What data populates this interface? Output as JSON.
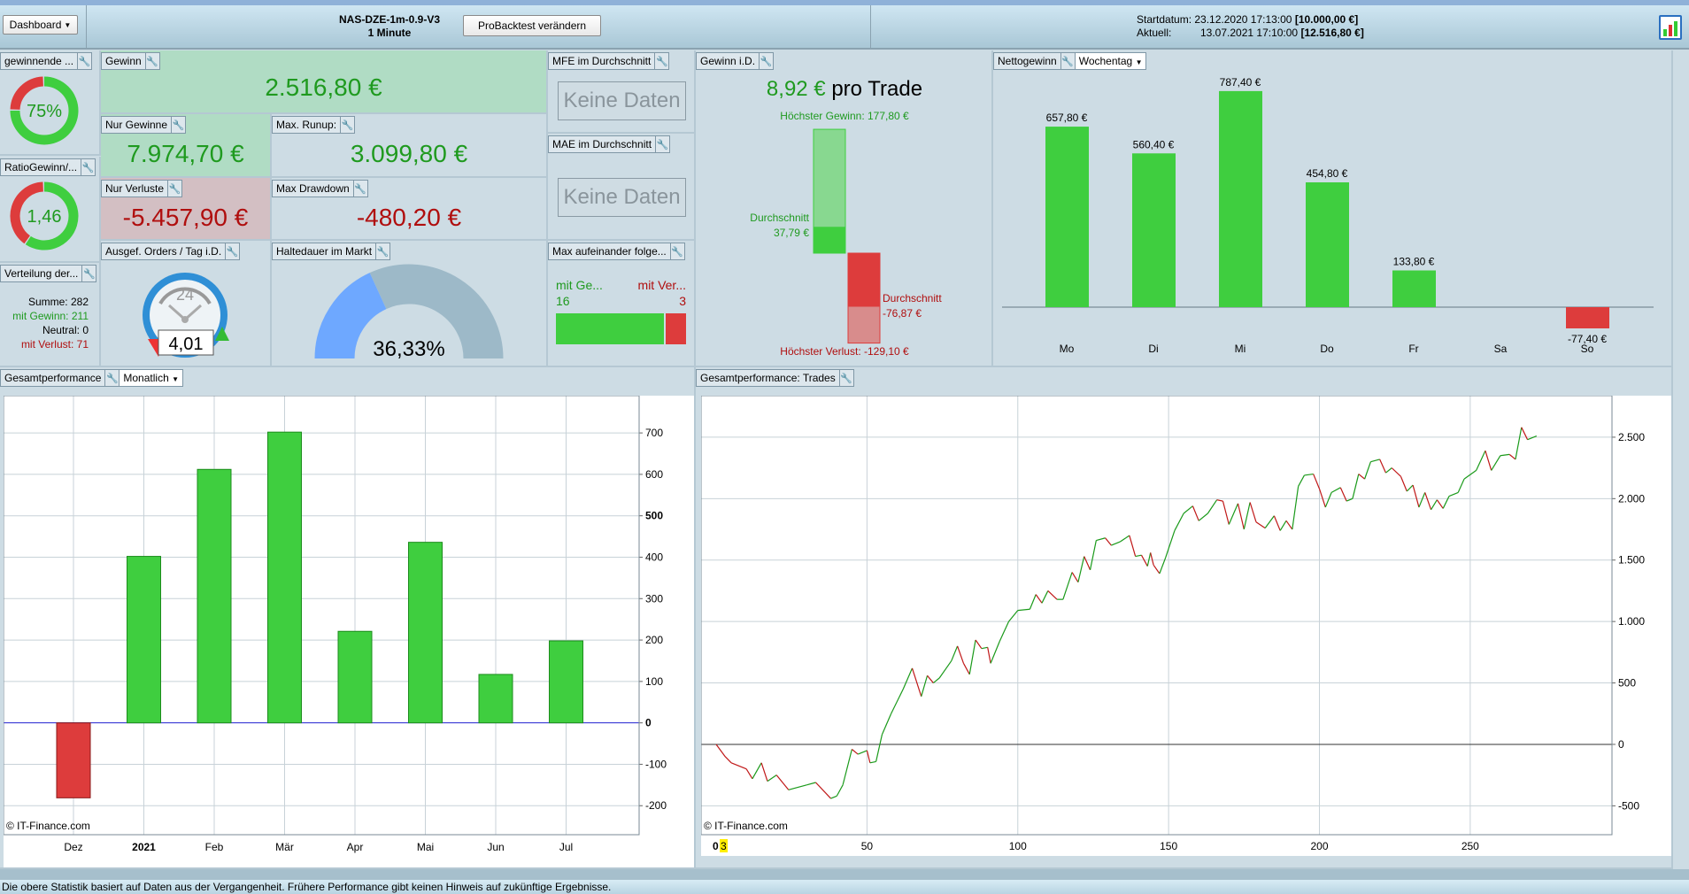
{
  "header": {
    "dashboard_label": "Dashboard",
    "strategy_name": "NAS-DZE-1m-0.9-V3",
    "timeframe": "1 Minute",
    "change_button": "ProBacktest verändern",
    "start_label": "Startdatum:",
    "start_date": "23.12.2020 17:13:00",
    "start_capital": "[10.000,00 €]",
    "current_label": "Aktuell:",
    "current_date": "13.07.2021 17:10:00",
    "current_capital": "[12.516,80 €]",
    "report_icon": "chart-report-icon"
  },
  "panels": {
    "winning": {
      "title": "gewinnende ...",
      "value": "75%",
      "fraction": 0.75
    },
    "ratio": {
      "title": "RatioGewinn/...",
      "value": "1,46",
      "fraction": 0.593
    },
    "distribution": {
      "title": "Verteilung der...",
      "sum_label": "Summe:",
      "sum": "282",
      "win_label": "mit Gewinn:",
      "win": "211",
      "neutral_label": "Neutral:",
      "neutral": "0",
      "loss_label": "mit Verlust:",
      "loss": "71"
    },
    "gewinn": {
      "title": "Gewinn",
      "value": "2.516,80 €"
    },
    "nur_gewinne": {
      "title": "Nur Gewinne",
      "value": "7.974,70 €"
    },
    "max_runup": {
      "title": "Max. Runup:",
      "value": "3.099,80 €"
    },
    "nur_verluste": {
      "title": "Nur Verluste",
      "value": "-5.457,90 €"
    },
    "max_drawdown": {
      "title": "Max Drawdown",
      "value": "-480,20 €"
    },
    "orders": {
      "title": "Ausgef. Orders / Tag i.D.",
      "clock_label": "24",
      "value": "4,01"
    },
    "haltedauer": {
      "title": "Haltedauer im Markt",
      "value": "36,33%",
      "fraction": 0.3633
    },
    "mfe": {
      "title": "MFE im Durchschnitt",
      "value": "Keine Daten"
    },
    "mae": {
      "title": "MAE im Durchschnitt",
      "value": "Keine Daten"
    },
    "consecutive": {
      "title": "Max aufeinander folge...",
      "win_label": "mit Ge...",
      "loss_label": "mit Ver...",
      "win": 16,
      "loss": 3
    },
    "gewinn_id": {
      "title": "Gewinn i.D.",
      "value": "8,92 €",
      "suffix": "pro Trade",
      "max_gain_label": "Höchster Gewinn: 177,80 €",
      "avg_label": "Durchschnitt",
      "avg_gain": "37,79 €",
      "avg_loss": "-76,87 €",
      "max_loss_label": "Höchster Verlust: -129,10 €",
      "max_gain": 177.8,
      "avg_gain_value": 37.79,
      "avg_loss_value": -76.87,
      "max_loss": -129.1
    },
    "netto": {
      "title": "Nettogewinn",
      "dropdown": "Wochentag"
    },
    "monthly": {
      "title": "Gesamtperformance",
      "dropdown": "Monatlich",
      "copyright": "© IT-Finance.com"
    },
    "trades": {
      "title": "Gesamtperformance: Trades",
      "copyright": "© IT-Finance.com",
      "cursor_x": "0",
      "cursor_badge": "3"
    }
  },
  "colors": {
    "green": "#3fce3f",
    "red": "#dd3c3c",
    "zero_line": "#2020d0",
    "accent_blue": "#6ea8ff"
  },
  "footer": {
    "disclaimer": "Die obere Statistik basiert auf Daten aus der Vergangenheit. Frühere Performance gibt keinen Hinweis auf zukünftige Ergebnisse."
  },
  "chart_data": [
    {
      "type": "bar",
      "categories": [
        "Mo",
        "Di",
        "Mi",
        "Do",
        "Fr",
        "Sa",
        "So"
      ],
      "values": [
        657.8,
        560.4,
        787.4,
        454.8,
        133.8,
        null,
        -77.4
      ],
      "labels": [
        "657,80 €",
        "560,40 €",
        "787,40 €",
        "454,80 €",
        "133,80 €",
        "",
        "-77,40 €"
      ]
    },
    {
      "type": "bar",
      "categories": [
        "Dez",
        "2021",
        "Feb",
        "Mär",
        "Apr",
        "Mai",
        "Jun",
        "Jul"
      ],
      "values": [
        -181,
        402,
        612,
        702,
        221,
        436,
        117,
        198
      ],
      "ylim": [
        -270,
        790
      ],
      "yticks": [
        -200,
        -100,
        0,
        100,
        200,
        300,
        400,
        500,
        600,
        700
      ],
      "ytick_labels": [
        "-200",
        "-100",
        "0",
        "100",
        "200",
        "300",
        "400",
        "500",
        "600",
        "700"
      ],
      "grid": true
    },
    {
      "type": "line",
      "xlim": [
        -5,
        297
      ],
      "ylim": [
        -735,
        2838
      ],
      "xticks": [
        50,
        100,
        150,
        200,
        250
      ],
      "xtick_labels": [
        "50",
        "100",
        "150",
        "200",
        "250"
      ],
      "yticks": [
        -500,
        0,
        500,
        1000,
        1500,
        2000,
        2500
      ],
      "ytick_labels": [
        "-500",
        "0",
        "500",
        "1.000",
        "1.500",
        "2.000",
        "2.500"
      ],
      "grid": true,
      "points": [
        [
          0,
          0
        ],
        [
          3,
          -100
        ],
        [
          5,
          -150
        ],
        [
          10,
          -200
        ],
        [
          12,
          -280
        ],
        [
          15,
          -150
        ],
        [
          17,
          -300
        ],
        [
          20,
          -250
        ],
        [
          24,
          -370
        ],
        [
          30,
          -330
        ],
        [
          33,
          -310
        ],
        [
          38,
          -440
        ],
        [
          40,
          -420
        ],
        [
          42,
          -330
        ],
        [
          45,
          -40
        ],
        [
          47,
          -80
        ],
        [
          50,
          -50
        ],
        [
          51,
          -150
        ],
        [
          53,
          -140
        ],
        [
          55,
          80
        ],
        [
          58,
          250
        ],
        [
          62,
          450
        ],
        [
          65,
          620
        ],
        [
          68,
          390
        ],
        [
          70,
          560
        ],
        [
          72,
          500
        ],
        [
          74,
          540
        ],
        [
          78,
          680
        ],
        [
          80,
          800
        ],
        [
          82,
          660
        ],
        [
          84,
          570
        ],
        [
          86,
          850
        ],
        [
          88,
          780
        ],
        [
          90,
          790
        ],
        [
          91,
          660
        ],
        [
          94,
          840
        ],
        [
          97,
          1000
        ],
        [
          100,
          1090
        ],
        [
          104,
          1100
        ],
        [
          106,
          1220
        ],
        [
          108,
          1150
        ],
        [
          110,
          1250
        ],
        [
          113,
          1180
        ],
        [
          115,
          1180
        ],
        [
          118,
          1400
        ],
        [
          120,
          1320
        ],
        [
          122,
          1530
        ],
        [
          124,
          1420
        ],
        [
          126,
          1660
        ],
        [
          129,
          1680
        ],
        [
          131,
          1620
        ],
        [
          134,
          1650
        ],
        [
          137,
          1700
        ],
        [
          139,
          1530
        ],
        [
          141,
          1540
        ],
        [
          143,
          1450
        ],
        [
          144,
          1560
        ],
        [
          145,
          1460
        ],
        [
          147,
          1390
        ],
        [
          149,
          1520
        ],
        [
          152,
          1740
        ],
        [
          155,
          1880
        ],
        [
          158,
          1940
        ],
        [
          160,
          1820
        ],
        [
          163,
          1880
        ],
        [
          166,
          1990
        ],
        [
          168,
          1980
        ],
        [
          170,
          1790
        ],
        [
          173,
          1960
        ],
        [
          175,
          1750
        ],
        [
          177,
          1970
        ],
        [
          179,
          1810
        ],
        [
          182,
          1760
        ],
        [
          185,
          1860
        ],
        [
          187,
          1740
        ],
        [
          189,
          1820
        ],
        [
          191,
          1750
        ],
        [
          193,
          2100
        ],
        [
          195,
          2190
        ],
        [
          198,
          2200
        ],
        [
          200,
          2080
        ],
        [
          202,
          1930
        ],
        [
          204,
          2050
        ],
        [
          207,
          2090
        ],
        [
          209,
          1980
        ],
        [
          211,
          2000
        ],
        [
          213,
          2200
        ],
        [
          215,
          2160
        ],
        [
          217,
          2300
        ],
        [
          220,
          2320
        ],
        [
          222,
          2210
        ],
        [
          224,
          2250
        ],
        [
          227,
          2180
        ],
        [
          229,
          2060
        ],
        [
          231,
          2110
        ],
        [
          233,
          1930
        ],
        [
          235,
          2050
        ],
        [
          237,
          1910
        ],
        [
          239,
          1990
        ],
        [
          241,
          1920
        ],
        [
          243,
          2020
        ],
        [
          246,
          2050
        ],
        [
          248,
          2160
        ],
        [
          252,
          2230
        ],
        [
          255,
          2390
        ],
        [
          257,
          2230
        ],
        [
          260,
          2350
        ],
        [
          263,
          2360
        ],
        [
          265,
          2320
        ],
        [
          267,
          2580
        ],
        [
          269,
          2480
        ],
        [
          272,
          2510
        ]
      ]
    }
  ]
}
